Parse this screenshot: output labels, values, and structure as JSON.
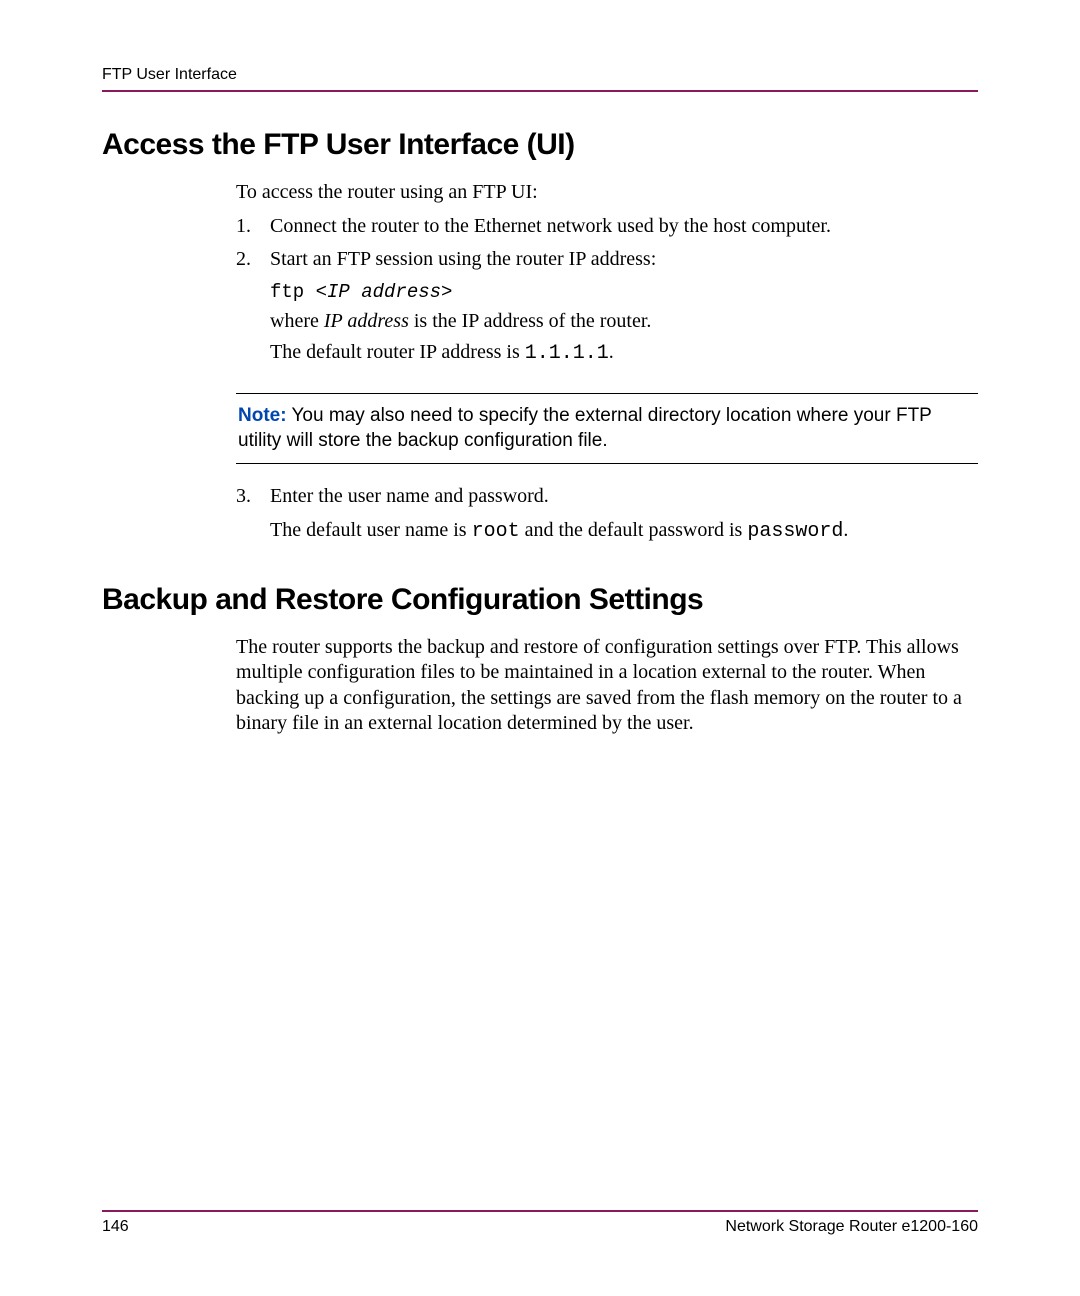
{
  "header": {
    "running": "FTP User Interface"
  },
  "section1": {
    "title": "Access the FTP User Interface (UI)",
    "intro": "To access the router using an FTP UI:",
    "step1_num": "1.",
    "step1_text": "Connect the router to the Ethernet network used by the host computer.",
    "step2_num": "2.",
    "step2_text": "Start an FTP session using the router IP address:",
    "code_cmd": "ftp ",
    "code_arg": "<IP address>",
    "where_pre": "where ",
    "where_ip": "IP address",
    "where_post": " is the IP address of the router.",
    "default_ip_pre": "The default router IP address is ",
    "default_ip_val": "1.1.1.1",
    "default_ip_post": ".",
    "note_label": "Note:",
    "note_text": "  You may also need to specify the external directory location where your FTP utility will store the backup configuration file.",
    "step3_num": "3.",
    "step3_text": "Enter the user name and password.",
    "creds_pre": "The default user name is ",
    "creds_user": "root",
    "creds_mid": " and the default password is ",
    "creds_pass": "password",
    "creds_post": "."
  },
  "section2": {
    "title": "Backup and Restore Configuration Settings",
    "para": "The router supports the backup and restore of configuration settings over FTP. This allows multiple configuration files to be maintained in a location external to the router. When backing up a configuration, the settings are saved from the flash memory on the router to a binary file in an external location determined by the user."
  },
  "footer": {
    "page_num": "146",
    "doc_title": "Network Storage Router e1200-160"
  }
}
